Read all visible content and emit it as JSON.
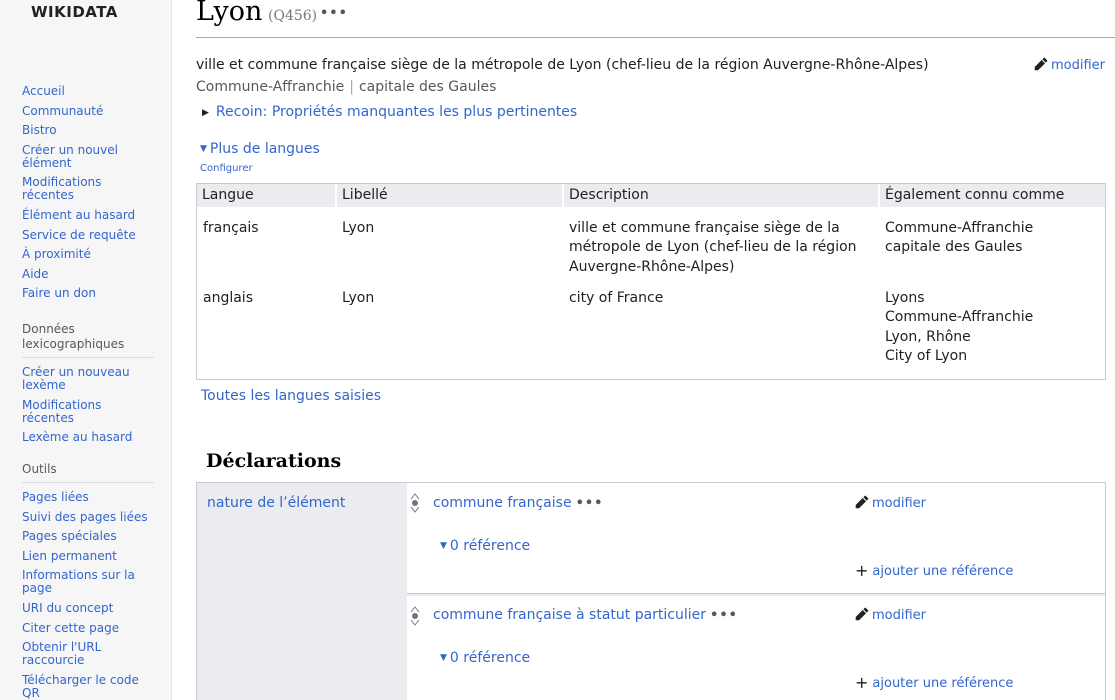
{
  "logo": "WIKIDATA",
  "sidebar": {
    "main_items": [
      "Accueil",
      "Communauté",
      "Bistro",
      "Créer un nouvel élément",
      "Modifications récentes",
      "Élément au hasard",
      "Service de requête",
      "À proximité",
      "Aide",
      "Faire un don"
    ],
    "lexeme_heading": "Données lexicographiques",
    "lexeme_items": [
      "Créer un nouveau lexème",
      "Modifications récentes",
      "Lexème au hasard"
    ],
    "tools_heading": "Outils",
    "tools_items": [
      "Pages liées",
      "Suivi des pages liées",
      "Pages spéciales",
      "Lien permanent",
      "Informations sur la page",
      "URI du concept",
      "Citer cette page",
      "Obtenir l'URL raccourcie",
      "Télécharger le code QR"
    ]
  },
  "entity": {
    "label": "Lyon",
    "qid": "(Q456)",
    "description": "ville et commune française siège de la métropole de Lyon (chef-lieu de la région Auvergne-Rhône-Alpes)",
    "aliases": [
      "Commune-Affranchie",
      "capitale des Gaules"
    ],
    "edit_label": "modifier"
  },
  "recoin_label": "Recoin: Propriétés manquantes les plus pertinentes",
  "more_languages_label": "Plus de langues",
  "configure_label": "Configurer",
  "lang_table": {
    "headers": [
      "Langue",
      "Libellé",
      "Description",
      "Également connu comme"
    ],
    "rows": [
      {
        "language": "français",
        "label": "Lyon",
        "description": [
          "ville et commune française siège de la",
          "métropole de Lyon (chef-lieu de la région",
          "Auvergne-Rhône-Alpes)"
        ],
        "aliases": [
          "Commune-Affranchie",
          "capitale des Gaules"
        ]
      },
      {
        "language": "anglais",
        "label": "Lyon",
        "description": [
          "city of France"
        ],
        "aliases": [
          "Lyons",
          "Commune-Affranchie",
          "Lyon, Rhône",
          "City of Lyon"
        ]
      }
    ]
  },
  "all_languages_label": "Toutes les langues saisies",
  "statements": {
    "heading": "Déclarations",
    "property_label": "nature de l’élément",
    "edit_label": "modifier",
    "references_label": "0 référence",
    "add_reference_label": "ajouter une référence",
    "values": [
      "commune française",
      "commune française à statut particulier"
    ]
  }
}
